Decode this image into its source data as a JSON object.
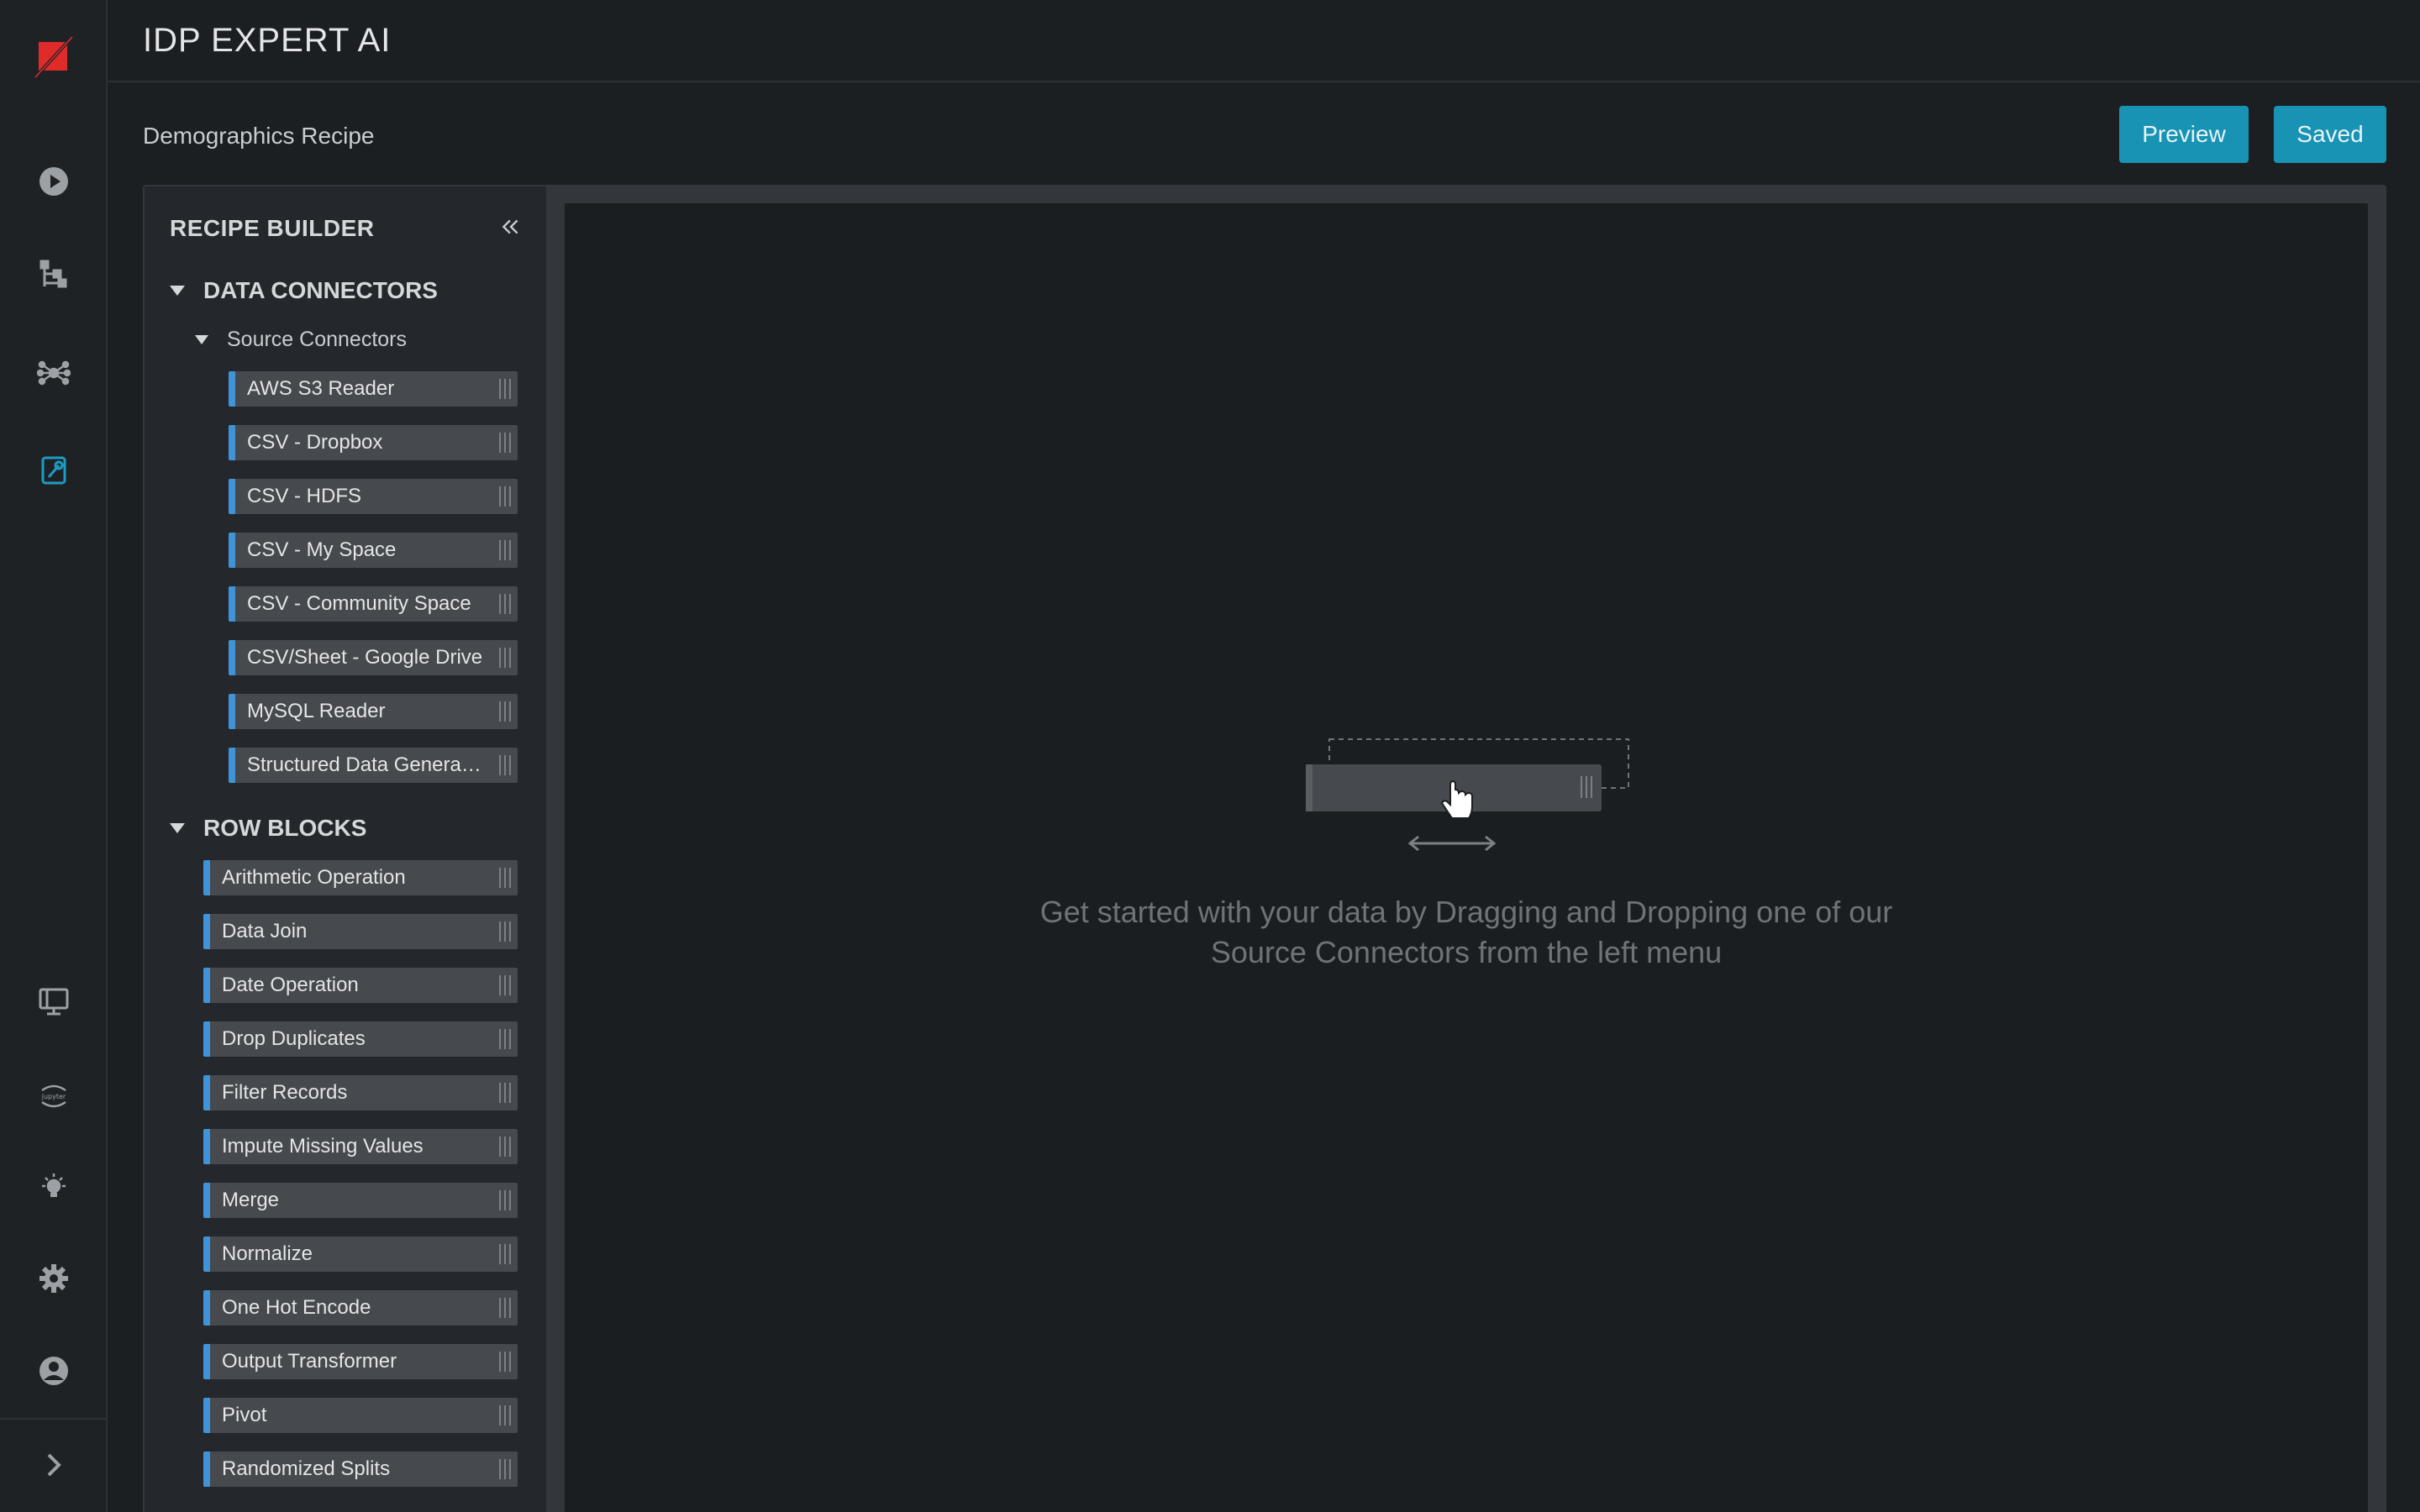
{
  "app": {
    "title": "IDP EXPERT AI"
  },
  "rail": {
    "icons": [
      "logo-icon",
      "play-icon",
      "pipeline-icon",
      "network-icon",
      "recipe-builder-icon",
      "desktop-icon",
      "jupyter-icon",
      "lightbulb-icon",
      "gear-icon",
      "user-icon",
      "chevron-right-icon"
    ],
    "active_color": "#1d9cc4"
  },
  "page": {
    "recipe_name": "Demographics Recipe",
    "preview_label": "Preview",
    "saved_label": "Saved"
  },
  "sidebar": {
    "title": "RECIPE BUILDER",
    "data_connectors": {
      "label": "DATA CONNECTORS",
      "source_connectors": {
        "label": "Source Connectors",
        "items": [
          "AWS S3 Reader",
          "CSV - Dropbox",
          "CSV - HDFS",
          "CSV - My Space",
          "CSV - Community Space",
          "CSV/Sheet - Google Drive",
          "MySQL Reader",
          "Structured Data Genera…"
        ]
      }
    },
    "row_blocks": {
      "label": "ROW BLOCKS",
      "items": [
        "Arithmetic Operation",
        "Data Join",
        "Date Operation",
        "Drop Duplicates",
        "Filter Records",
        "Impute Missing Values",
        "Merge",
        "Normalize",
        "One Hot Encode",
        "Output Transformer",
        "Pivot",
        "Randomized Splits"
      ]
    }
  },
  "canvas": {
    "hint_line1": "Get started with your data by Dragging and Dropping one of our",
    "hint_line2": "Source Connectors from the left menu"
  },
  "colors": {
    "accent": "#1893b4",
    "item_stripe": "#3f94d8"
  }
}
